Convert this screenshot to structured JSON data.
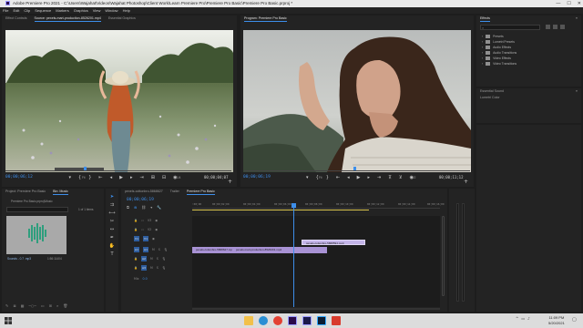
{
  "window": {
    "title": "Adobe Premiere Pro 2021 - C:\\Users\\Wajahat\\Videos\\Wajahat Photoshop\\Client Work\\Learn Premiere Pro\\Premiere Pro Basic\\Premiere Pro Basic.prproj *",
    "minimize": "—",
    "maximize": "☐",
    "close": "✕"
  },
  "menu": [
    "File",
    "Edit",
    "Clip",
    "Sequence",
    "Markers",
    "Graphics",
    "View",
    "Window",
    "Help"
  ],
  "source": {
    "tabs": [
      "Effect Controls",
      "Source: pexels-mart-production-8526201.mp4",
      "Essential Graphics"
    ],
    "timecode": "00;00;06;12",
    "fit": "Fit",
    "ratio": "1/4",
    "duration": "00;00;04;07"
  },
  "program": {
    "tab": "Program: Premiere Pro Basic",
    "timecode": "00;00;06;19",
    "fit": "Fit",
    "ratio": "1/2",
    "duration": "00;00;11;12"
  },
  "effects": {
    "title": "Effects",
    "items": [
      "Presets",
      "Lumetri Presets",
      "Audio Effects",
      "Audio Transitions",
      "Video Effects",
      "Video Transitions"
    ],
    "essential_sound": "Essential Sound",
    "lumetri": "Lumetri Color"
  },
  "project": {
    "tabs": [
      "Project: Premiere Pro Basic",
      "Bin: Music"
    ],
    "path": "Premiere Pro Basic.prproj\\Music",
    "count": "1 of 1 items",
    "item_name": "Sounds - 0.7 .mp3",
    "item_duration": "1:56:11404"
  },
  "timeline": {
    "tabs": [
      "pexels-cottonbro-5868627",
      "Trailer",
      "Premiere Pro Basic"
    ],
    "timecode": "00;00;06;19",
    "ruler": [
      ":00;00",
      "00;00;02;00",
      "00;00;04;00",
      "00;00;06;00",
      "00;00;08;00",
      "00;00;10;00",
      "00;00;12;00",
      "00;00;14;00",
      "00;00;16;00"
    ],
    "video_tracks": [
      "V3",
      "V2",
      "V1"
    ],
    "audio_tracks": [
      "A1",
      "A2",
      "A3"
    ],
    "mix": "Mix",
    "mix_value": "0.0",
    "clips": [
      {
        "name": "pexels-cottonbro-5868627.mp4 [V]",
        "color": "#a892d4"
      },
      {
        "name": "pexels-mart-production-8526201.mp4",
        "color": "#a892d4"
      },
      {
        "name": "pexels-cottonbro-5868594.mp4",
        "color": "#c3b4e8"
      }
    ]
  },
  "taskbar": {
    "time": "11:09 PM",
    "date": "5/20/2021"
  },
  "colors": {
    "accent": "#3d8eea",
    "clip": "#a892d4",
    "panel": "#232323"
  }
}
